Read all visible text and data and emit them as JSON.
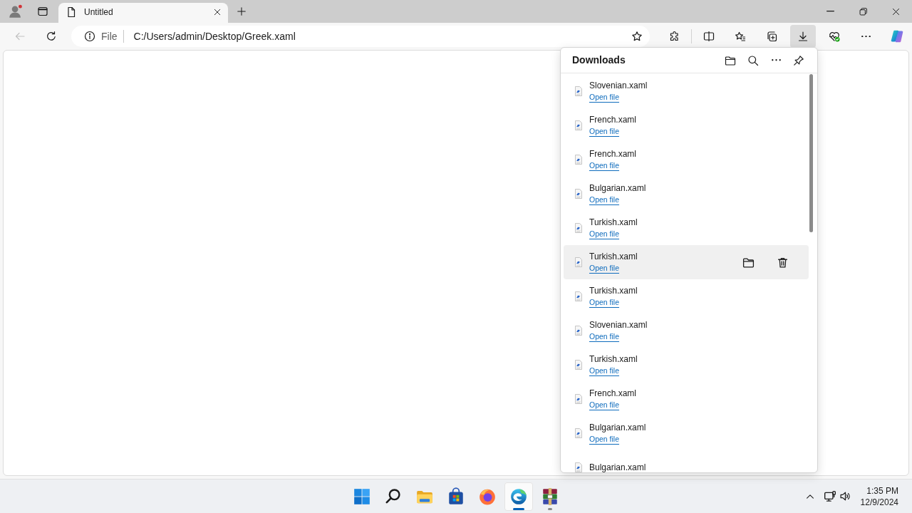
{
  "tabs": [
    {
      "title": "Untitled",
      "selected": true
    }
  ],
  "nav_buttons": [
    {
      "kind": "back",
      "disabled": true
    },
    {
      "kind": "refresh",
      "disabled": false
    }
  ],
  "address_bar": {
    "scheme": "File",
    "url": "C:/Users/admin/Desktop/Greek.xaml"
  },
  "toolbar_buttons": [
    {
      "kind": "extensions",
      "selected": false
    },
    {
      "kind": "split_screen",
      "selected": false
    },
    {
      "kind": "favorites",
      "selected": false
    },
    {
      "kind": "collections",
      "selected": false
    },
    {
      "kind": "downloads",
      "selected": true
    },
    {
      "kind": "browser_essentials",
      "selected": false
    },
    {
      "kind": "more",
      "selected": false
    },
    {
      "kind": "copilot",
      "selected": false
    }
  ],
  "downloads": {
    "title": "Downloads",
    "items": [
      {
        "name": "Slovenian.xaml",
        "link": "Open file",
        "hovered": false
      },
      {
        "name": "French.xaml",
        "link": "Open file",
        "hovered": false
      },
      {
        "name": "French.xaml",
        "link": "Open file",
        "hovered": false
      },
      {
        "name": "Bulgarian.xaml",
        "link": "Open file",
        "hovered": false
      },
      {
        "name": "Turkish.xaml",
        "link": "Open file",
        "hovered": false
      },
      {
        "name": "Turkish.xaml",
        "link": "Open file",
        "hovered": true
      },
      {
        "name": "Turkish.xaml",
        "link": "Open file",
        "hovered": false
      },
      {
        "name": "Slovenian.xaml",
        "link": "Open file",
        "hovered": false
      },
      {
        "name": "Turkish.xaml",
        "link": "Open file",
        "hovered": false
      },
      {
        "name": "French.xaml",
        "link": "Open file",
        "hovered": false
      },
      {
        "name": "Bulgarian.xaml",
        "link": "Open file",
        "hovered": false
      },
      {
        "name": "Bulgarian.xaml",
        "hovered": false
      }
    ]
  },
  "taskbar": {
    "apps": [
      {
        "kind": "start",
        "selected": false,
        "running": false
      },
      {
        "kind": "search",
        "selected": false,
        "running": false
      },
      {
        "kind": "explorer",
        "selected": false,
        "running": false
      },
      {
        "kind": "store",
        "selected": false,
        "running": false
      },
      {
        "kind": "firefox",
        "selected": false,
        "running": false
      },
      {
        "kind": "edge",
        "selected": true,
        "running": true
      },
      {
        "kind": "winrar",
        "selected": false,
        "running": true
      }
    ],
    "clock": {
      "time": "1:35 PM",
      "date": "12/9/2024"
    }
  }
}
